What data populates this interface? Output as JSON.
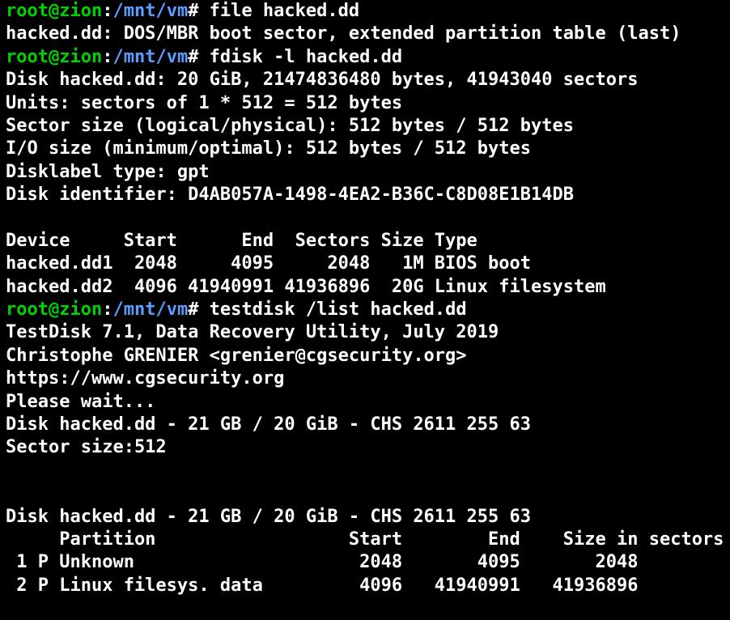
{
  "prompt": {
    "user_host": "root@zion",
    "separator": ":",
    "path": "/mnt/vm",
    "symbol": "#"
  },
  "colors": {
    "background": "#000000",
    "text": "#ffffff",
    "prompt_user": "#00d200",
    "prompt_path": "#5c9cff"
  },
  "lines": [
    {
      "type": "command",
      "text": " file hacked.dd"
    },
    {
      "type": "output",
      "text": "hacked.dd: DOS/MBR boot sector, extended partition table (last)"
    },
    {
      "type": "command",
      "text": " fdisk -l hacked.dd"
    },
    {
      "type": "output",
      "text": "Disk hacked.dd: 20 GiB, 21474836480 bytes, 41943040 sectors"
    },
    {
      "type": "output",
      "text": "Units: sectors of 1 * 512 = 512 bytes"
    },
    {
      "type": "output",
      "text": "Sector size (logical/physical): 512 bytes / 512 bytes"
    },
    {
      "type": "output",
      "text": "I/O size (minimum/optimal): 512 bytes / 512 bytes"
    },
    {
      "type": "output",
      "text": "Disklabel type: gpt"
    },
    {
      "type": "output",
      "text": "Disk identifier: D4AB057A-1498-4EA2-B36C-C8D08E1B14DB"
    },
    {
      "type": "output",
      "text": ""
    },
    {
      "type": "output",
      "text": "Device     Start      End  Sectors Size Type"
    },
    {
      "type": "output",
      "text": "hacked.dd1  2048     4095     2048   1M BIOS boot"
    },
    {
      "type": "output",
      "text": "hacked.dd2  4096 41940991 41936896  20G Linux filesystem"
    },
    {
      "type": "command",
      "text": " testdisk /list hacked.dd"
    },
    {
      "type": "output",
      "text": "TestDisk 7.1, Data Recovery Utility, July 2019"
    },
    {
      "type": "output",
      "text": "Christophe GRENIER <grenier@cgsecurity.org>"
    },
    {
      "type": "output",
      "text": "https://www.cgsecurity.org"
    },
    {
      "type": "output",
      "text": "Please wait..."
    },
    {
      "type": "output",
      "text": "Disk hacked.dd - 21 GB / 20 GiB - CHS 2611 255 63"
    },
    {
      "type": "output",
      "text": "Sector size:512"
    },
    {
      "type": "output",
      "text": ""
    },
    {
      "type": "output",
      "text": ""
    },
    {
      "type": "output",
      "text": "Disk hacked.dd - 21 GB / 20 GiB - CHS 2611 255 63"
    },
    {
      "type": "output",
      "text": "     Partition                  Start        End    Size in sectors"
    },
    {
      "type": "output",
      "text": " 1 P Unknown                     2048       4095       2048"
    },
    {
      "type": "output",
      "text": " 2 P Linux filesys. data         4096   41940991   41936896"
    }
  ]
}
